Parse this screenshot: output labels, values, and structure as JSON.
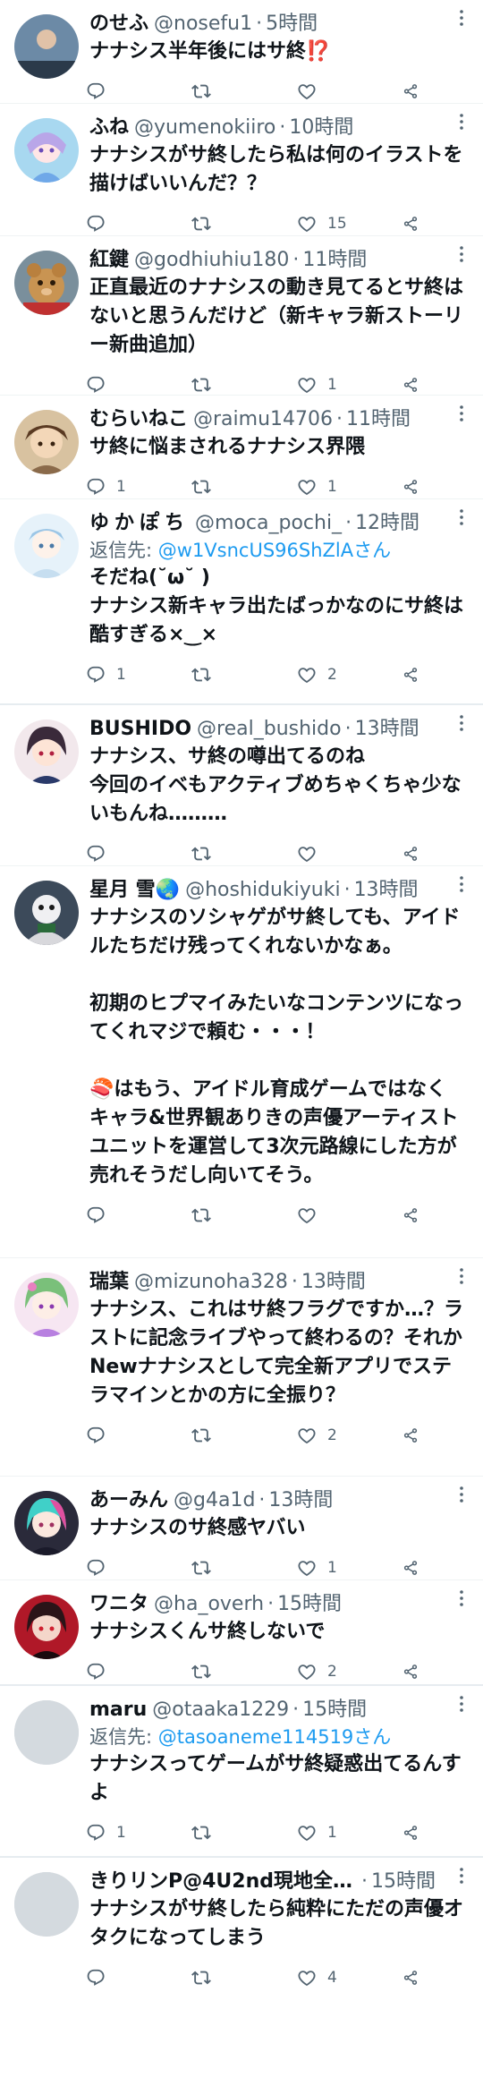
{
  "tweets": [
    {
      "name": "のせふ",
      "handle": "@nosefu1",
      "time": "5時間",
      "text": "ナナシス半年後にはサ終⁉️",
      "replies": "",
      "retweets": "",
      "likes": ""
    },
    {
      "name": "ふね",
      "handle": "@yumenokiiro",
      "time": "10時間",
      "text": "ナナシスがサ終したら私は何のイラストを描けばいいんだ？？",
      "replies": "",
      "retweets": "",
      "likes": "15"
    },
    {
      "name": "紅鍵",
      "handle": "@godhiuhiu180",
      "time": "11時間",
      "text": "正直最近のナナシスの動き見てるとサ終はないと思うんだけど（新キャラ新ストーリー新曲追加）",
      "replies": "",
      "retweets": "",
      "likes": "1"
    },
    {
      "name": "むらいねこ",
      "handle": "@raimu14706",
      "time": "11時間",
      "text": "サ終に悩まされるナナシス界隈",
      "replies": "1",
      "retweets": "",
      "likes": "1"
    },
    {
      "name": "ゆかぽち",
      "handle": "@moca_pochi_",
      "time": "12時間",
      "reply_to_label": "返信先: ",
      "reply_to": "@w1VsncUS96ShZlAさん",
      "text": "そだね(˘ω˘ )\nナナシス新キャラ出たばっかなのにサ終は酷すぎる×‿×",
      "replies": "1",
      "retweets": "",
      "likes": "2"
    },
    {
      "name": "BUSHIDO",
      "handle": "@real_bushido",
      "time": "13時間",
      "text": "ナナシス、サ終の噂出てるのね\n今回のイベもアクティブめちゃくちゃ少ないもんね………",
      "replies": "",
      "retweets": "",
      "likes": ""
    },
    {
      "name": "星月 雪🌏",
      "handle": "@hoshidukiyuki",
      "time": "13時間",
      "text": "ナナシスのソシャゲがサ終しても、アイドルたちだけ残ってくれないかなぁ。\n\n初期のヒプマイみたいなコンテンツになってくれマジで頼む・・・！\n\n🍣はもう、アイドル育成ゲームではなくキャラ&世界観ありきの声優アーティストユニットを運営して3次元路線にした方が売れそうだし向いてそう。",
      "replies": "",
      "retweets": "",
      "likes": ""
    },
    {
      "name": "瑞葉",
      "handle": "@mizunoha328",
      "time": "13時間",
      "text": "ナナシス、これはサ終フラグですか…？ラストに記念ライブやって終わるの？それかNewナナシスとして完全新アプリでステラマインとかの方に全振り？",
      "replies": "",
      "retweets": "",
      "likes": "2"
    },
    {
      "name": "あーみん",
      "handle": "@g4a1d",
      "time": "13時間",
      "text": "ナナシスのサ終感ヤバい",
      "replies": "",
      "retweets": "",
      "likes": "1"
    },
    {
      "name": "ワニタ",
      "handle": "@ha_overh",
      "time": "15時間",
      "text": "ナナシスくんサ終しないで",
      "replies": "",
      "retweets": "",
      "likes": "2"
    },
    {
      "name": "maru",
      "handle": "@otaaka1229",
      "time": "15時間",
      "reply_to_label": "返信先: ",
      "reply_to": "@tasoaneme114519さん",
      "text": "ナナシスってゲームがサ終疑惑出てるんすよ",
      "replies": "1",
      "retweets": "",
      "likes": "1"
    },
    {
      "name": "きりリンP@4U2nd現地全…",
      "handle": "",
      "time": "15時間",
      "text": "ナナシスがサ終したら純粋にただの声優オタクになってしまう",
      "replies": "",
      "retweets": "",
      "likes": "4"
    }
  ],
  "colors": {
    "text": "#0f1419",
    "secondary": "#536471",
    "link": "#1d9bf0",
    "separator": "#eff3f4"
  },
  "icons": [
    "reply-icon",
    "retweet-icon",
    "like-icon",
    "share-icon",
    "more-icon"
  ]
}
